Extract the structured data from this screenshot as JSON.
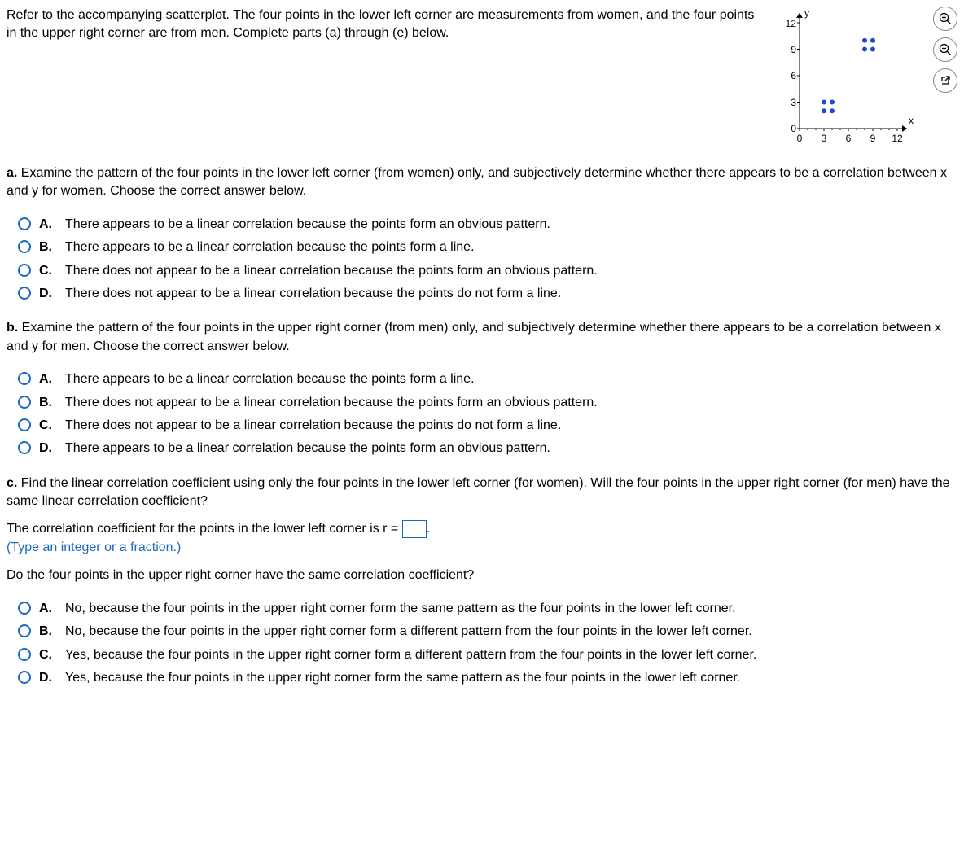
{
  "intro": "Refer to the accompanying scatterplot. The four points in the lower left corner are measurements from women, and the four points in the upper right corner are from men. Complete parts (a) through (e) below.",
  "chart_data": {
    "type": "scatter",
    "xlabel": "x",
    "ylabel": "y",
    "xlim": [
      0,
      12
    ],
    "ylim": [
      0,
      12
    ],
    "xticks": [
      0,
      3,
      6,
      9,
      12
    ],
    "yticks": [
      0,
      3,
      6,
      9,
      12
    ],
    "series": [
      {
        "name": "women",
        "points": [
          [
            3,
            2
          ],
          [
            4,
            2
          ],
          [
            3,
            3
          ],
          [
            4,
            3
          ]
        ]
      },
      {
        "name": "men",
        "points": [
          [
            8,
            9
          ],
          [
            9,
            9
          ],
          [
            8,
            10
          ],
          [
            9,
            10
          ]
        ]
      }
    ]
  },
  "parts": {
    "a": {
      "label": "a.",
      "text": "Examine the pattern of the four points in the lower left corner (from women) only, and subjectively determine whether there appears to be a correlation between x and y for women. Choose the correct answer below.",
      "options": [
        {
          "letter": "A.",
          "text": "There appears to be a linear correlation because the points form an obvious pattern."
        },
        {
          "letter": "B.",
          "text": "There appears to be a linear correlation because the points form a line."
        },
        {
          "letter": "C.",
          "text": "There does not appear to be a linear correlation because the points form an obvious pattern."
        },
        {
          "letter": "D.",
          "text": "There does not appear to be a linear correlation because the points do not form a line."
        }
      ]
    },
    "b": {
      "label": "b.",
      "text": "Examine the pattern of the four points in the upper right corner (from men) only, and subjectively determine whether there appears to be a correlation between x and y for men. Choose the correct answer below.",
      "options": [
        {
          "letter": "A.",
          "text": "There appears to be a linear correlation because the points form a line."
        },
        {
          "letter": "B.",
          "text": "There does not appear to be a linear correlation because the points form an obvious pattern."
        },
        {
          "letter": "C.",
          "text": "There does not appear to be a linear correlation because the points do not form a line."
        },
        {
          "letter": "D.",
          "text": "There appears to be a linear correlation because the points form an obvious pattern."
        }
      ]
    },
    "c": {
      "label": "c.",
      "text": "Find the linear correlation coefficient using only the four points in the lower left corner (for women). Will the four points in the upper right corner (for men) have the same linear correlation coefficient?",
      "fill_pre": "The correlation coefficient for the points in the lower left corner is r = ",
      "fill_post": ".",
      "hint": "(Type an integer or a fraction.)",
      "subq": "Do the four points in the upper right corner have the same correlation coefficient?",
      "options": [
        {
          "letter": "A.",
          "text": "No, because the four points in the upper right corner form the same pattern as the four points in the lower left corner."
        },
        {
          "letter": "B.",
          "text": "No, because the four points in the upper right corner form a different pattern from the four points in the lower left corner."
        },
        {
          "letter": "C.",
          "text": "Yes, because the four points in the upper right corner form a different pattern from the four points in the lower left corner."
        },
        {
          "letter": "D.",
          "text": "Yes, because the four points in the upper right corner form the same pattern as the four points in the lower left corner."
        }
      ]
    }
  }
}
